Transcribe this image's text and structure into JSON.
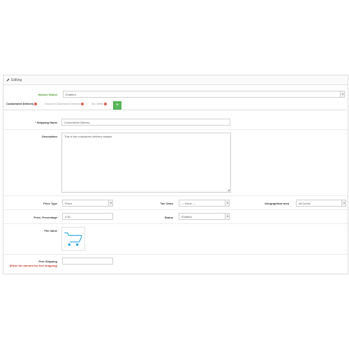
{
  "panel": {
    "title": "Editing"
  },
  "module_status": {
    "label": "Module Status",
    "value": "Enabled"
  },
  "tabs": [
    {
      "label": "Customized Delivery",
      "active": true
    },
    {
      "label": "Second Customized Delivery",
      "active": false
    },
    {
      "label": "3rd Tofifill",
      "active": false
    }
  ],
  "add_tab_symbol": "+",
  "form": {
    "shipping_name": {
      "label": "* Shipping Name",
      "value": "Customized Delivery"
    },
    "description": {
      "label": "Description",
      "value": "This is the customized delivery sample"
    },
    "price_type": {
      "label": "Price Type",
      "value": "Fixed"
    },
    "tax_class": {
      "label": "Tax Class",
      "value": "--- None ---"
    },
    "geo_zone": {
      "label": "Geographical area",
      "value": "All Zones"
    },
    "price_percentage": {
      "label": "Price, Percentage",
      "value": "4.00"
    },
    "status": {
      "label": "Status",
      "value": "Enabled"
    },
    "file_name": {
      "label": "File name"
    },
    "free_shipping": {
      "label": "Free Shipping",
      "note": "(Enter the amount for free shipping)",
      "value": ""
    }
  },
  "colors": {
    "accent_green": "#5cb85c",
    "label_green": "#4a9a2e",
    "error_red": "#c0392b",
    "delete_red": "#e05a4c",
    "cart_blue": "#29a3e0"
  },
  "icons": {
    "heading": "pencil-icon",
    "thumbnail": "shopping-cart-icon",
    "tab_delete": "minus-circle-icon"
  }
}
